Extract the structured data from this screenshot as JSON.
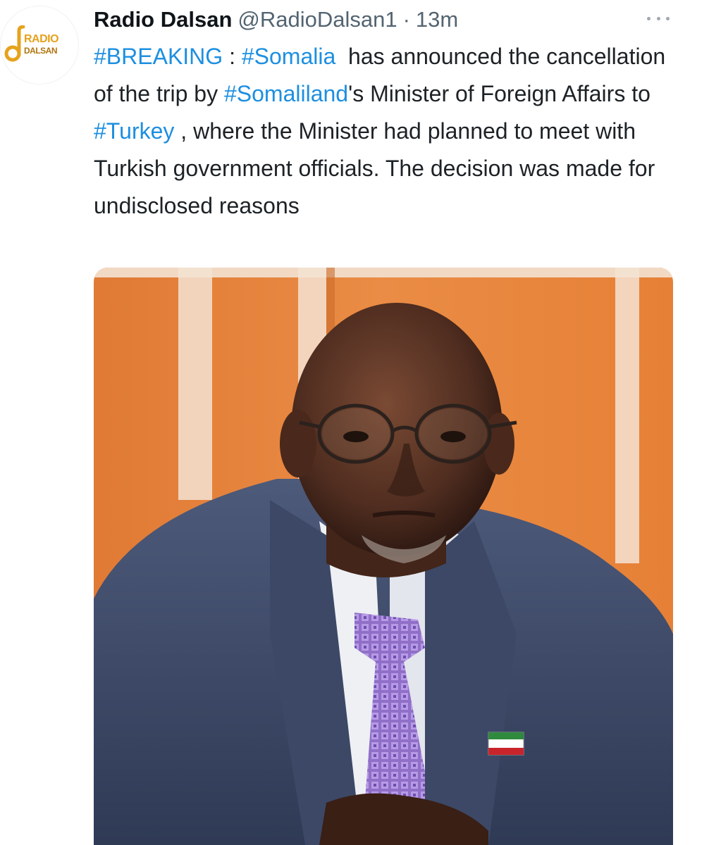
{
  "account": {
    "name": "Radio Dalsan",
    "handle": "@RadioDalsan1",
    "separator": "·",
    "time": "13m",
    "avatar_logo": {
      "line1": "RADIO",
      "line2": "DALSAN"
    }
  },
  "tweet": {
    "hashtag_breaking": "#BREAKING",
    "colon": " : ",
    "hashtag_somalia": "#Somalia",
    "text_1": "  has announced the cancellation of the trip by ",
    "hashtag_somaliland": "#Somaliland",
    "text_2": "'s Minister of Foreign Affairs to ",
    "hashtag_turkey": "#Turkey",
    "text_3": " , where the Minister had planned to meet with Turkish government officials. The decision was made for undisclosed reasons"
  },
  "icons": {
    "more": "more-horizontal-icon"
  },
  "colors": {
    "hashtag": "#1d8fe0",
    "secondary_text": "#536471",
    "brand_orange": "#e6a21d"
  }
}
